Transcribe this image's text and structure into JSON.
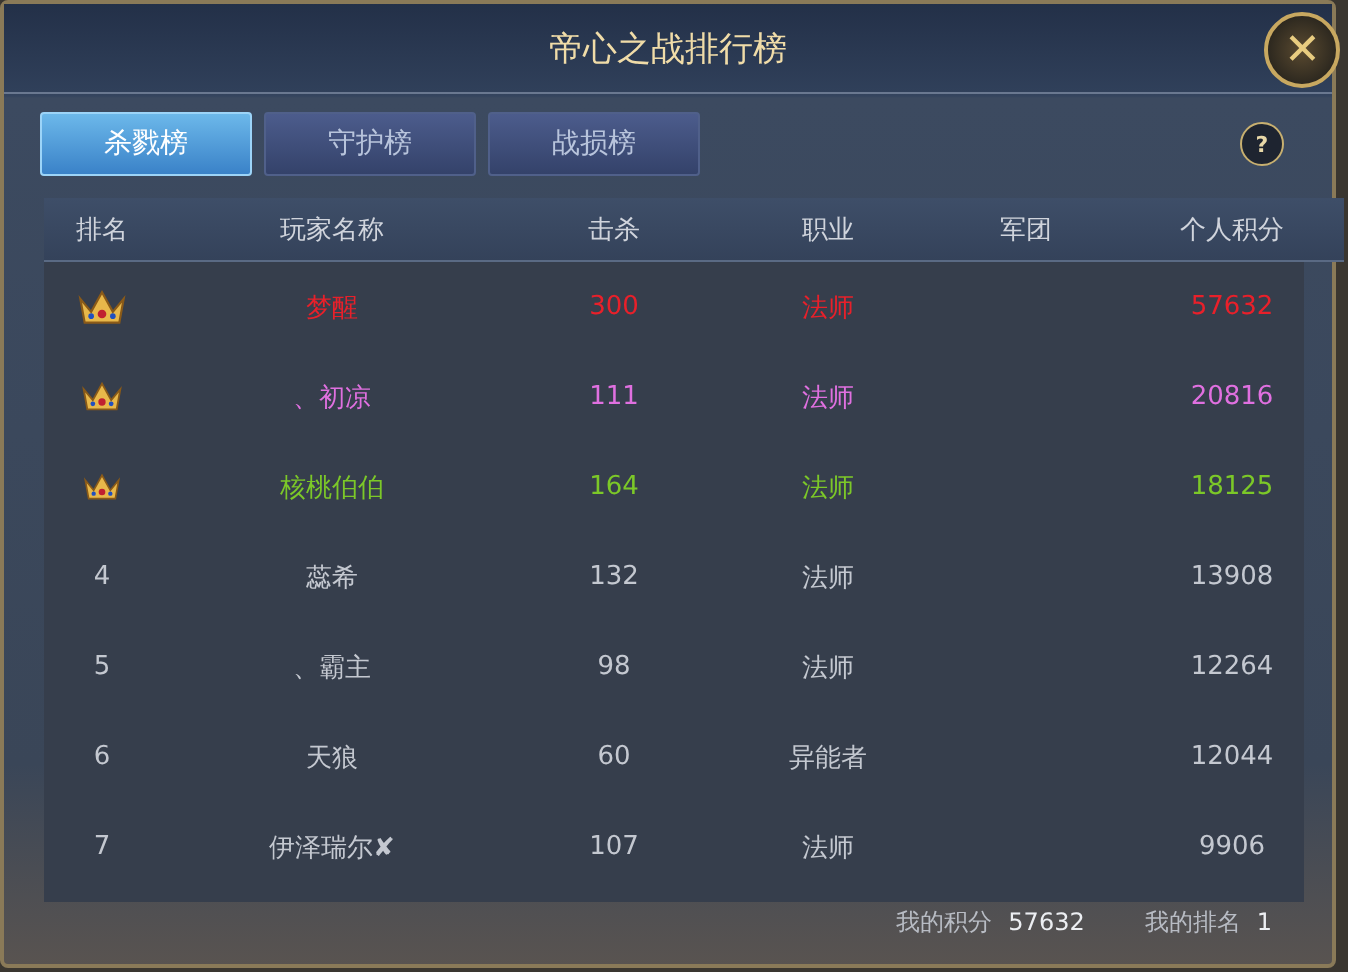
{
  "window": {
    "title": "帝心之战排行榜",
    "close": "✕",
    "help": "?"
  },
  "tabs": [
    {
      "label": "杀戮榜",
      "selected": true
    },
    {
      "label": "守护榜",
      "selected": false
    },
    {
      "label": "战损榜",
      "selected": false
    }
  ],
  "table": {
    "columns": [
      "排名",
      "玩家名称",
      "击杀",
      "职业",
      "军团",
      "个人积分"
    ],
    "rows": [
      {
        "kind": "crown",
        "color": "#e8202a",
        "name": "梦醒",
        "kills": "300",
        "class": "法师",
        "score": "57632"
      },
      {
        "kind": "crown",
        "color": "#e070e0",
        "name": "、初凉",
        "kills": "111",
        "class": "法师",
        "score": "20816"
      },
      {
        "kind": "crown",
        "color": "#7cc828",
        "name": "核桃伯伯",
        "kills": "164",
        "class": "法师",
        "score": "18125"
      },
      {
        "kind": "number",
        "rank": "4",
        "color": "#c4c8d0",
        "name": "蕊希",
        "kills": "132",
        "class": "法师",
        "score": "13908"
      },
      {
        "kind": "number",
        "rank": "5",
        "color": "#c4c8d0",
        "name": "、霸主",
        "kills": "98",
        "class": "法师",
        "score": "12264"
      },
      {
        "kind": "number",
        "rank": "6",
        "color": "#c4c8d0",
        "name": "天狼",
        "kills": "60",
        "class": "异能者",
        "score": "12044"
      },
      {
        "kind": "number",
        "rank": "7",
        "color": "#c4c8d0",
        "name": "伊泽瑞尔✘",
        "kills": "107",
        "class": "法师",
        "score": "9906"
      }
    ]
  },
  "footer": {
    "score_label": "我的积分",
    "score": "57632",
    "rank_label": "我的排名",
    "rank": "1"
  }
}
